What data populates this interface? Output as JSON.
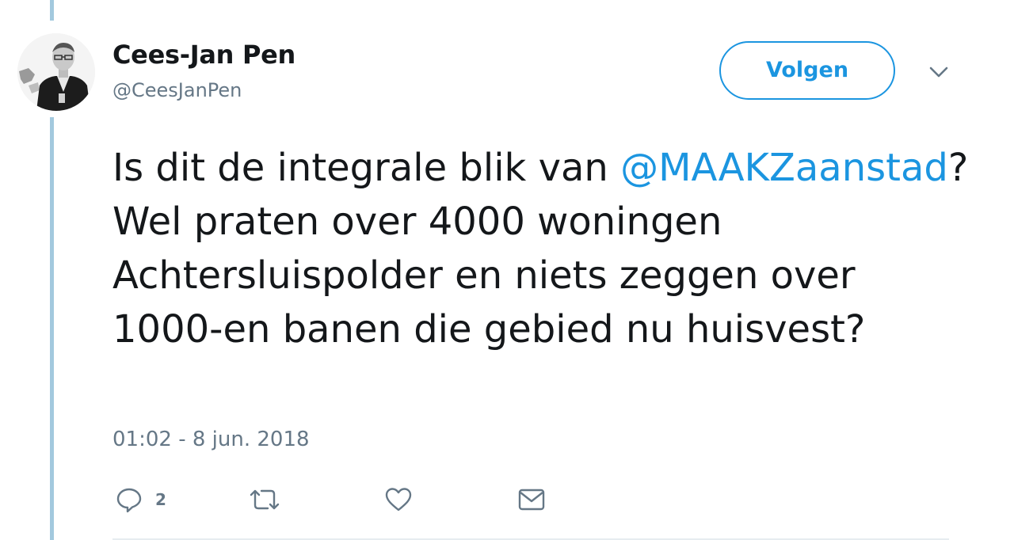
{
  "author": {
    "display_name": "Cees-Jan Pen",
    "handle": "@CeesJanPen"
  },
  "follow_button": {
    "label": "Volgen"
  },
  "more_menu": {
    "icon": "chevron-down-icon"
  },
  "tweet": {
    "text_before_mention": "Is dit de integrale blik van ",
    "mention": "@MAAKZaanstad",
    "text_after_mention": "? Wel praten over 4000 woningen Achtersluispolder en niets zeggen over 1000-en banen die gebied nu huisvest?",
    "timestamp": "01:02 - 8 jun. 2018"
  },
  "actions": {
    "reply": {
      "icon": "reply-icon",
      "count": "2"
    },
    "retweet": {
      "icon": "retweet-icon"
    },
    "like": {
      "icon": "heart-icon"
    },
    "message": {
      "icon": "envelope-icon"
    }
  },
  "colors": {
    "accent": "#1b95e0",
    "text": "#14171a",
    "secondary_text": "#657786",
    "thread_line": "#a3c9de"
  }
}
